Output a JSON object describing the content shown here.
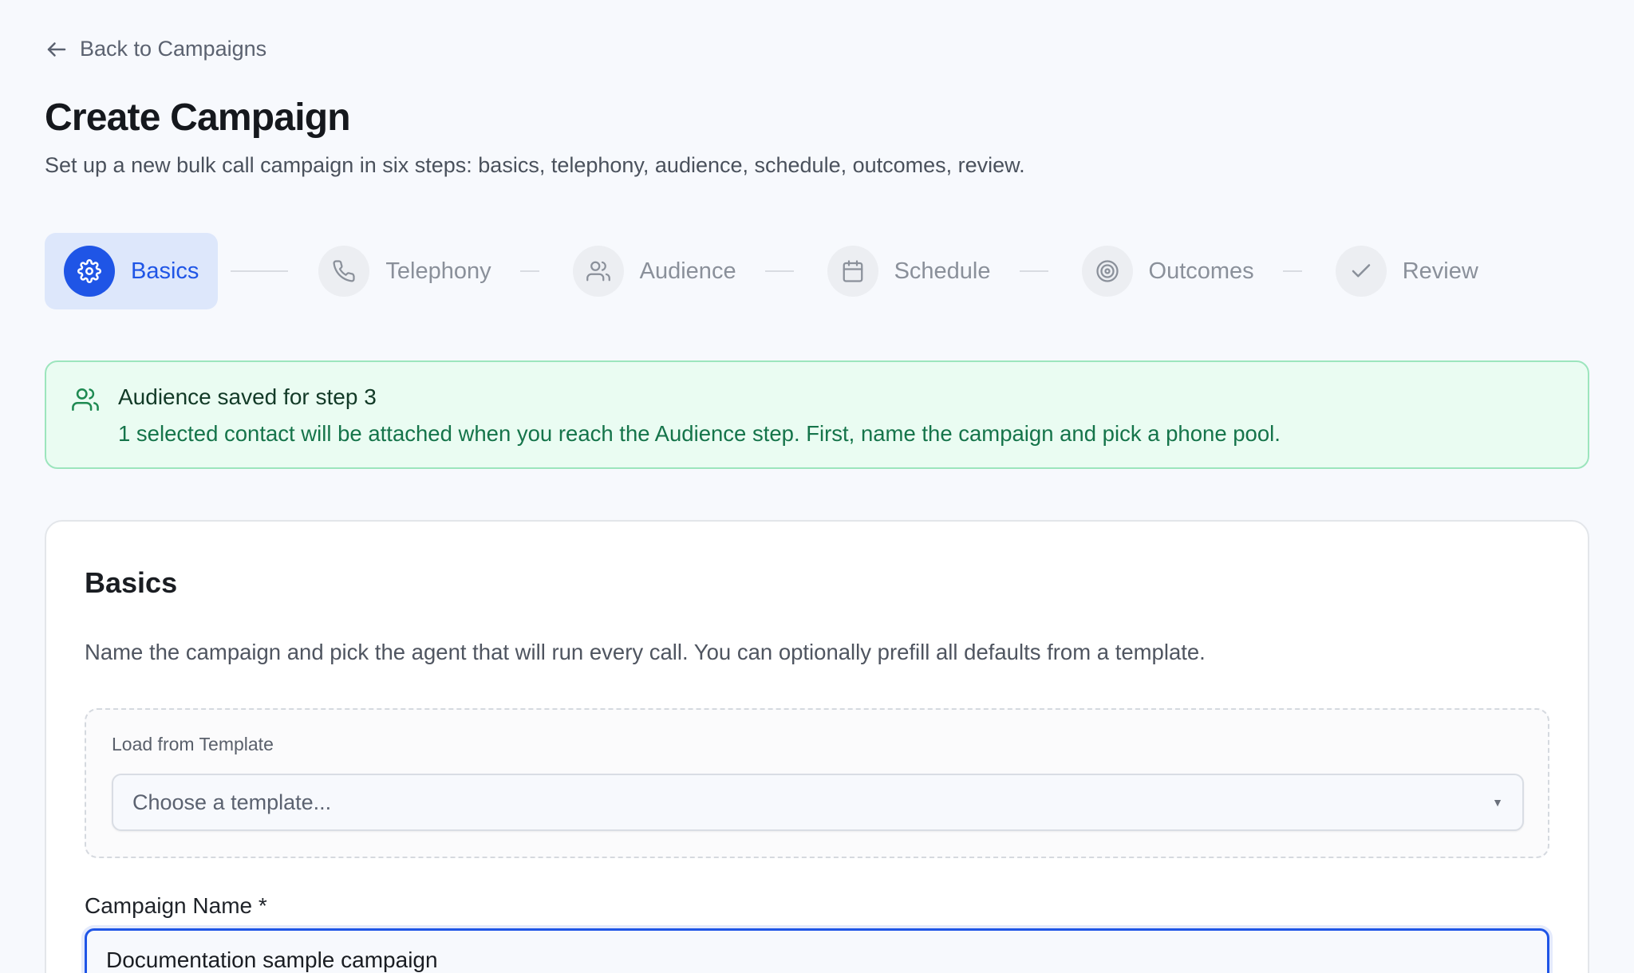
{
  "nav": {
    "back_label": "Back to Campaigns"
  },
  "header": {
    "title": "Create Campaign",
    "subtitle": "Set up a new bulk call campaign in six steps: basics, telephony, audience, schedule, outcomes, review."
  },
  "steps": [
    {
      "label": "Basics",
      "icon": "gear-icon",
      "active": true
    },
    {
      "label": "Telephony",
      "icon": "phone-icon",
      "active": false
    },
    {
      "label": "Audience",
      "icon": "users-icon",
      "active": false
    },
    {
      "label": "Schedule",
      "icon": "calendar-icon",
      "active": false
    },
    {
      "label": "Outcomes",
      "icon": "target-icon",
      "active": false
    },
    {
      "label": "Review",
      "icon": "check-icon",
      "active": false
    }
  ],
  "alert": {
    "icon": "users-icon",
    "title": "Audience saved for step 3",
    "text": "1 selected contact will be attached when you reach the Audience step. First, name the campaign and pick a phone pool."
  },
  "basics": {
    "title": "Basics",
    "description": "Name the campaign and pick the agent that will run every call. You can optionally prefill all defaults from a template.",
    "template": {
      "label": "Load from Template",
      "placeholder": "Choose a template...",
      "selected": "Choose a template..."
    },
    "campaign_name": {
      "label": "Campaign Name *",
      "value": "Documentation sample campaign"
    }
  },
  "colors": {
    "accent": "#1f55e6",
    "accent_bg": "#dde7fb",
    "success_bg": "#eafcf2",
    "success_border": "#9ce5bd",
    "success_text": "#15744a",
    "page_bg": "#f7f9fd"
  }
}
